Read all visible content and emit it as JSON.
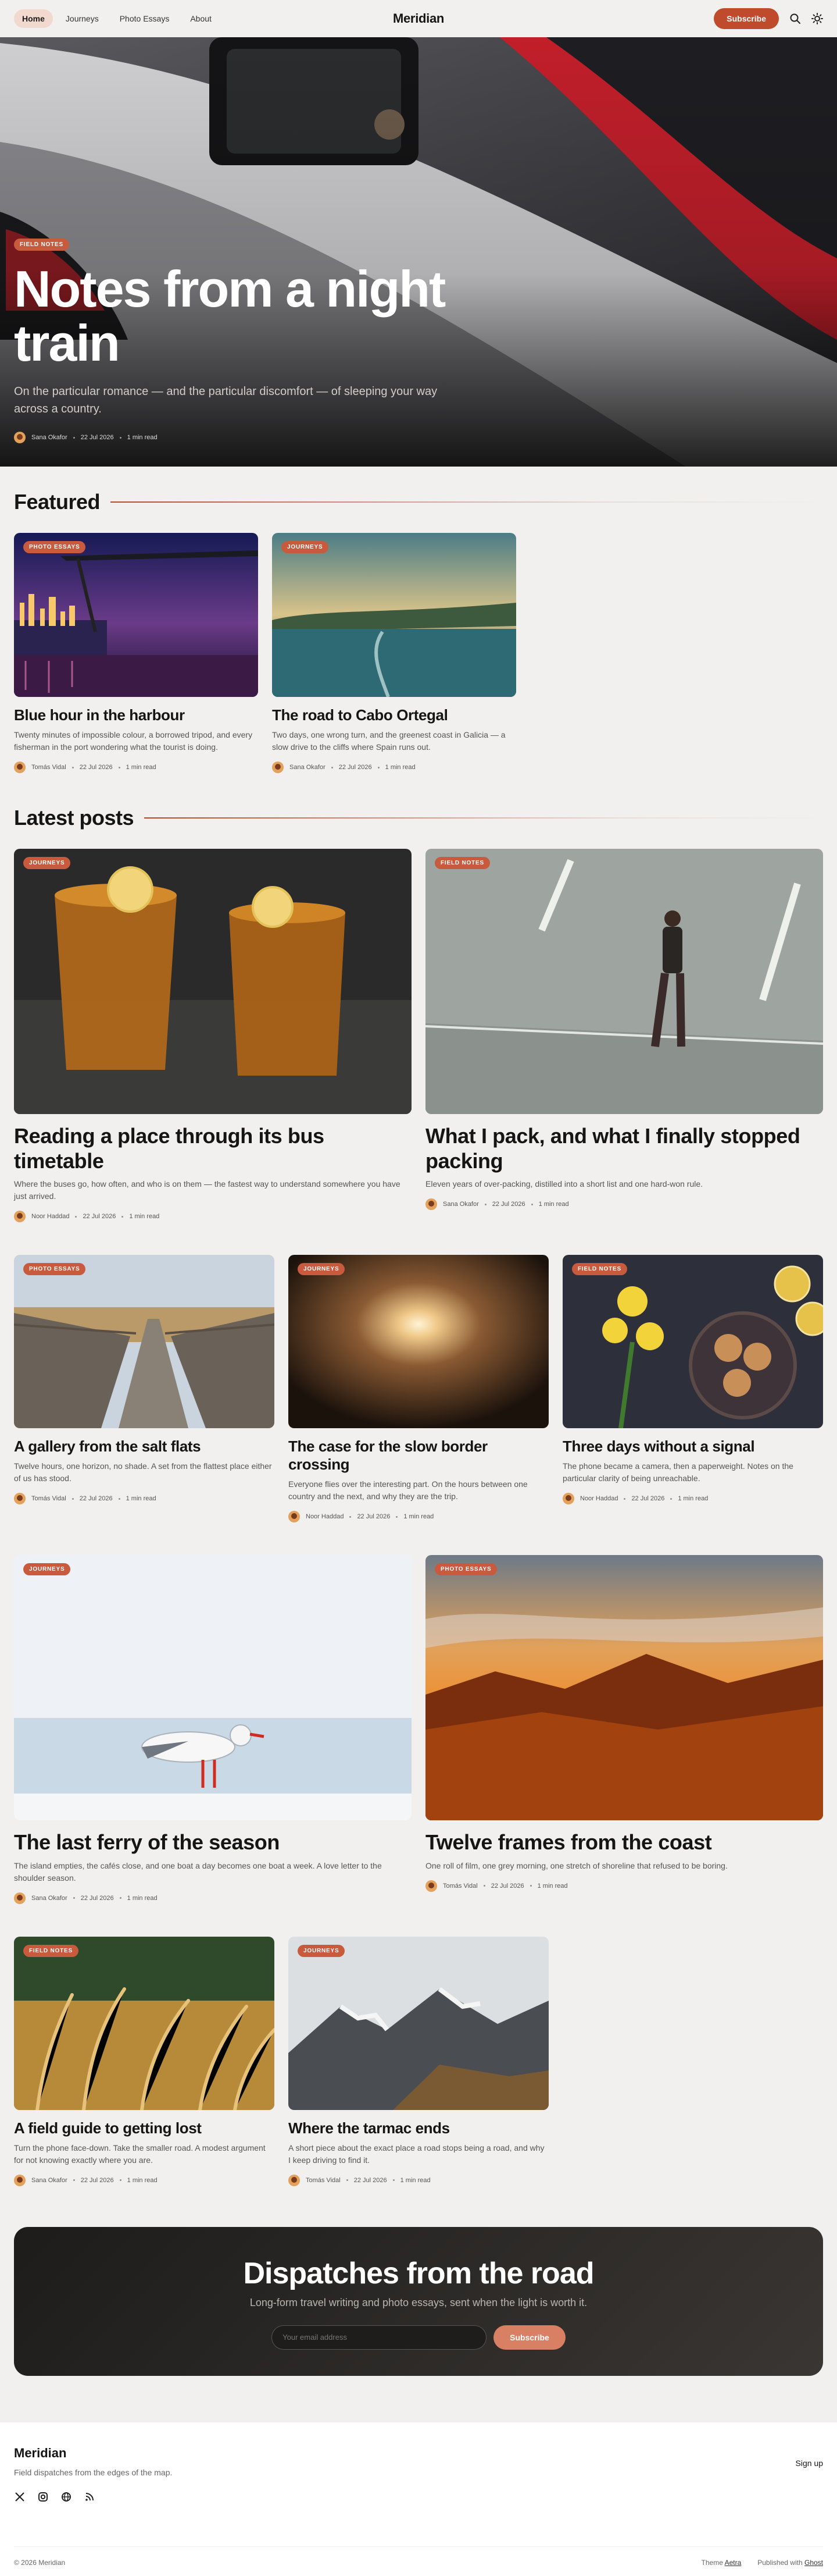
{
  "header": {
    "nav": [
      "Home",
      "Journeys",
      "Photo Essays",
      "About"
    ],
    "logo": "Meridian",
    "subscribe": "Subscribe"
  },
  "hero": {
    "tag": "FIELD NOTES",
    "title": "Notes from a night train",
    "excerpt": "On the particular romance — and the particular discomfort — of sleeping your way across a country.",
    "author": "Sana Okafor",
    "date": "22 Jul 2026",
    "read": "1 min read"
  },
  "featured": {
    "title": "Featured",
    "posts": [
      {
        "tag": "PHOTO ESSAYS",
        "title": "Blue hour in the harbour",
        "excerpt": "Twenty minutes of impossible colour, a borrowed tripod, and every fisherman in the port wondering what the tourist is doing.",
        "author": "Tomás Vidal",
        "date": "22 Jul 2026",
        "read": "1 min read"
      },
      {
        "tag": "JOURNEYS",
        "title": "The road to Cabo Ortegal",
        "excerpt": "Two days, one wrong turn, and the greenest coast in Galicia — a slow drive to the cliffs where Spain runs out.",
        "author": "Sana Okafor",
        "date": "22 Jul 2026",
        "read": "1 min read"
      }
    ]
  },
  "latest": {
    "title": "Latest posts",
    "row1": [
      {
        "tag": "JOURNEYS",
        "title": "Reading a place through its bus timetable",
        "excerpt": "Where the buses go, how often, and who is on them — the fastest way to understand somewhere you have just arrived.",
        "author": "Noor Haddad",
        "date": "22 Jul 2026",
        "read": "1 min read"
      },
      {
        "tag": "FIELD NOTES",
        "title": "What I pack, and what I finally stopped packing",
        "excerpt": "Eleven years of over-packing, distilled into a short list and one hard-won rule.",
        "author": "Sana Okafor",
        "date": "22 Jul 2026",
        "read": "1 min read"
      }
    ],
    "row2": [
      {
        "tag": "PHOTO ESSAYS",
        "title": "A gallery from the salt flats",
        "excerpt": "Twelve hours, one horizon, no shade. A set from the flattest place either of us has stood.",
        "author": "Tomás Vidal",
        "date": "22 Jul 2026",
        "read": "1 min read"
      },
      {
        "tag": "JOURNEYS",
        "title": "The case for the slow border crossing",
        "excerpt": "Everyone flies over the interesting part. On the hours between one country and the next, and why they are the trip.",
        "author": "Noor Haddad",
        "date": "22 Jul 2026",
        "read": "1 min read"
      },
      {
        "tag": "FIELD NOTES",
        "title": "Three days without a signal",
        "excerpt": "The phone became a camera, then a paperweight. Notes on the particular clarity of being unreachable.",
        "author": "Noor Haddad",
        "date": "22 Jul 2026",
        "read": "1 min read"
      }
    ],
    "row3": [
      {
        "tag": "JOURNEYS",
        "title": "The last ferry of the season",
        "excerpt": "The island empties, the cafés close, and one boat a day becomes one boat a week. A love letter to the shoulder season.",
        "author": "Sana Okafor",
        "date": "22 Jul 2026",
        "read": "1 min read"
      },
      {
        "tag": "PHOTO ESSAYS",
        "title": "Twelve frames from the coast",
        "excerpt": "One roll of film, one grey morning, one stretch of shoreline that refused to be boring.",
        "author": "Tomás Vidal",
        "date": "22 Jul 2026",
        "read": "1 min read"
      }
    ],
    "row4": [
      {
        "tag": "FIELD NOTES",
        "title": "A field guide to getting lost",
        "excerpt": "Turn the phone face-down. Take the smaller road. A modest argument for not knowing exactly where you are.",
        "author": "Sana Okafor",
        "date": "22 Jul 2026",
        "read": "1 min read"
      },
      {
        "tag": "JOURNEYS",
        "title": "Where the tarmac ends",
        "excerpt": "A short piece about the exact place a road stops being a road, and why I keep driving to find it.",
        "author": "Tomás Vidal",
        "date": "22 Jul 2026",
        "read": "1 min read"
      }
    ]
  },
  "newsletter": {
    "title": "Dispatches from the road",
    "subtitle": "Long-form travel writing and photo essays, sent when the light is worth it.",
    "placeholder": "Your email address",
    "button": "Subscribe"
  },
  "footer": {
    "brand": "Meridian",
    "desc": "Field dispatches from the edges of the map.",
    "signup": "Sign up",
    "copyright": "© 2026 Meridian",
    "theme_label": "Theme",
    "theme_link": "Aetra",
    "published_label": "Published with",
    "published_link": "Ghost"
  },
  "colors": {
    "accent": "#bf4a2c",
    "tag": "#c85a3e"
  }
}
